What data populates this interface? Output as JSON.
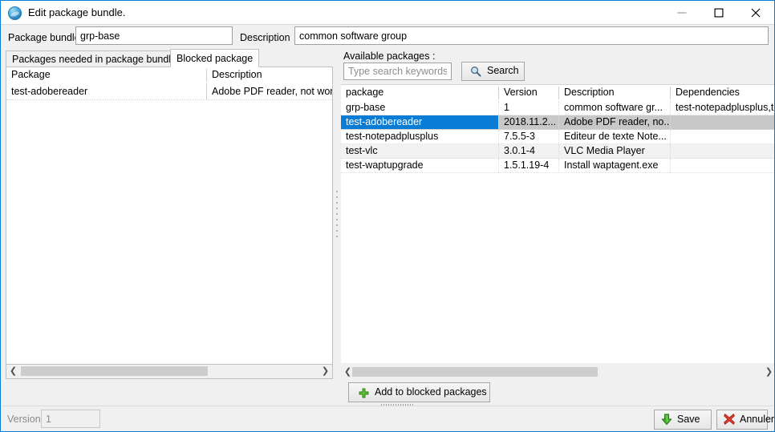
{
  "window": {
    "title": "Edit package bundle.",
    "icon": "globe-icon",
    "accent_color": "#0a7cd5",
    "controls": {
      "minimize": "minimize-icon",
      "maximize": "maximize-icon",
      "close": "close-icon"
    }
  },
  "form": {
    "bundle_label": "Package bundle",
    "bundle_value": "grp-base",
    "description_label": "Description",
    "description_value": "common software group"
  },
  "left_panel": {
    "tabs": [
      {
        "label": "Packages needed in package bundle",
        "active": false
      },
      {
        "label": "Blocked package",
        "active": true
      }
    ],
    "grid": {
      "columns": [
        "Package",
        "Description"
      ],
      "rows": [
        {
          "package": "test-adobereader",
          "description": "Adobe PDF reader, not work w"
        }
      ]
    },
    "scrollbar": {
      "left_arrow": "chevron-left-icon",
      "right_arrow": "chevron-right-icon"
    }
  },
  "right_panel": {
    "available_label": "Available packages :",
    "search_placeholder": "Type search keywords",
    "search_value": "",
    "search_button_label": "Search",
    "search_button_icon": "magnifier-icon",
    "grid": {
      "columns": [
        "package",
        "Version",
        "Description",
        "Dependencies"
      ],
      "sort_column": "package",
      "sort_direction": "ascending",
      "rows": [
        {
          "package": "grp-base",
          "version": "1",
          "description": "common software gr...",
          "dependencies": "test-notepadplusplus,te",
          "selected": false
        },
        {
          "package": "test-adobereader",
          "version": "2018.11.2...",
          "description": "Adobe PDF reader, no...",
          "dependencies": "",
          "selected": true
        },
        {
          "package": "test-notepadplusplus",
          "version": "7.5.5-3",
          "description": "Editeur de texte Note...",
          "dependencies": "",
          "selected": false
        },
        {
          "package": "test-vlc",
          "version": "3.0.1-4",
          "description": "VLC Media Player",
          "dependencies": "",
          "selected": false
        },
        {
          "package": "test-waptupgrade",
          "version": "1.5.1.19-4",
          "description": "Install waptagent.exe",
          "dependencies": "",
          "selected": false
        }
      ]
    },
    "scrollbar": {
      "left_arrow": "chevron-left-icon",
      "right_arrow": "chevron-right-icon"
    },
    "add_button_label": "Add to blocked packages",
    "add_button_icon": "plus-icon"
  },
  "footer": {
    "version_label": "Version",
    "version_value": "1",
    "save_label": "Save",
    "save_icon": "download-arrow-icon",
    "cancel_label": "Annuler",
    "cancel_icon": "red-x-icon"
  }
}
